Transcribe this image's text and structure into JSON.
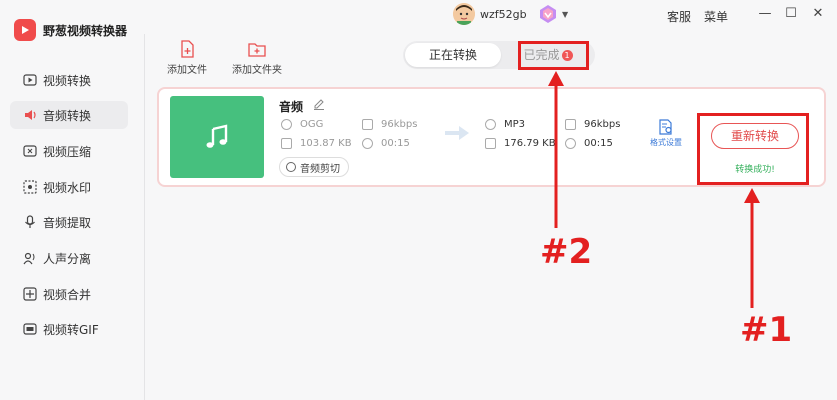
{
  "app": {
    "title": "野葱视频转换器"
  },
  "header": {
    "username": "wzf52gb",
    "links": {
      "support": "客服",
      "menu": "菜单"
    }
  },
  "window_controls": {
    "minimize": "—",
    "maximize": "☐",
    "close": "✕"
  },
  "sidebar": {
    "items": [
      {
        "label": "视频转换",
        "icon": "video-convert-icon",
        "active": false
      },
      {
        "label": "音频转换",
        "icon": "audio-convert-icon",
        "active": true
      },
      {
        "label": "视频压缩",
        "icon": "video-compress-icon",
        "active": false
      },
      {
        "label": "视频水印",
        "icon": "video-watermark-icon",
        "active": false
      },
      {
        "label": "音频提取",
        "icon": "audio-extract-icon",
        "active": false
      },
      {
        "label": "人声分离",
        "icon": "voice-separate-icon",
        "active": false
      },
      {
        "label": "视频合并",
        "icon": "video-merge-icon",
        "active": false
      },
      {
        "label": "视频转GIF",
        "icon": "gif-icon",
        "active": false
      }
    ]
  },
  "toolbar": {
    "add_file": "添加文件",
    "add_folder": "添加文件夹"
  },
  "tabs": {
    "converting": "正在转换",
    "completed": "已完成",
    "completed_count": "1"
  },
  "file": {
    "name": "音频",
    "source": {
      "format": "OGG",
      "bitrate": "96kbps",
      "size": "103.87 KB",
      "duration": "00:15"
    },
    "target": {
      "format": "MP3",
      "bitrate": "96kbps",
      "size": "176.79 KB",
      "duration": "00:15"
    },
    "cut_label": "音频剪切",
    "format_settings": "格式设置",
    "reconvert_label": "重新转换",
    "status": "转换成功!"
  },
  "annotations": {
    "callout_1": "#1",
    "callout_2": "#2",
    "color": "#e32020"
  },
  "colors": {
    "accent": "#e94f4f",
    "thumb": "#46c07e",
    "success": "#35b05c",
    "link": "#3d7bd8"
  }
}
